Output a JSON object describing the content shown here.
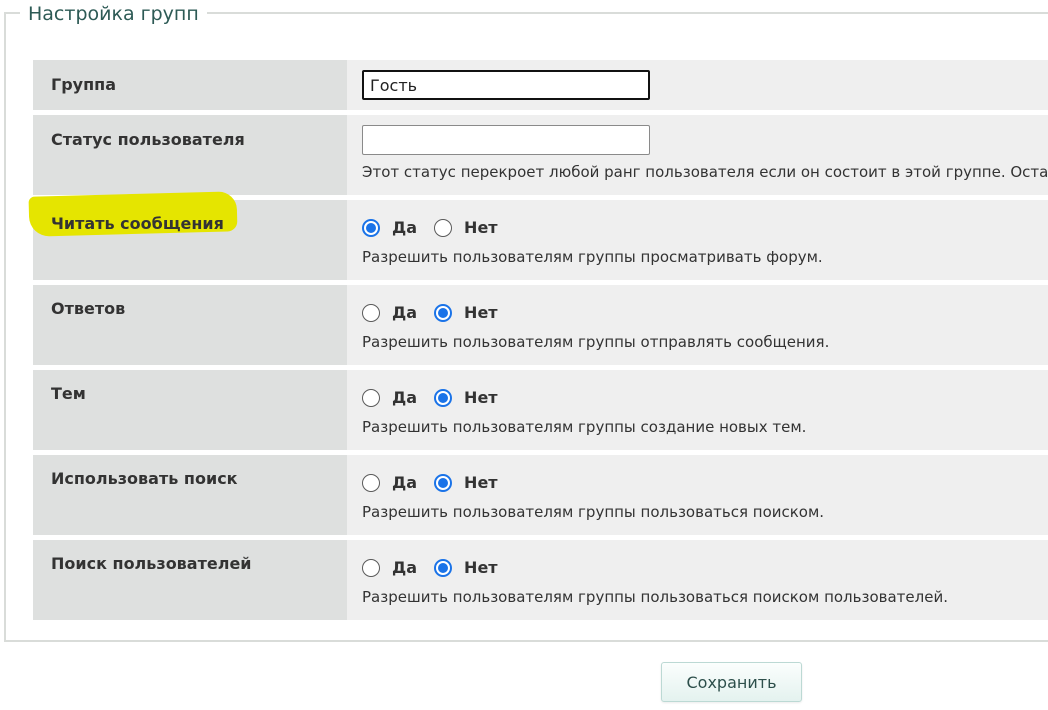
{
  "fieldset": {
    "legend": "Настройка групп"
  },
  "rows": {
    "group": {
      "label": "Группа",
      "value": "Гость"
    },
    "status": {
      "label": "Статус пользователя",
      "value": "",
      "description": "Этот статус перекроет любой ранг пользователя если он состоит в этой группе. Оста"
    },
    "read": {
      "label": "Читать сообщения",
      "yes": "Да",
      "no": "Нет",
      "selected": "yes",
      "description": "Разрешить пользователям группы просматривать форум."
    },
    "replies": {
      "label": "Ответов",
      "yes": "Да",
      "no": "Нет",
      "selected": "no",
      "description": "Разрешить пользователям группы отправлять сообщения."
    },
    "topics": {
      "label": "Тем",
      "yes": "Да",
      "no": "Нет",
      "selected": "no",
      "description": "Разрешить пользователям группы создание новых тем."
    },
    "search": {
      "label": "Использовать поиск",
      "yes": "Да",
      "no": "Нет",
      "selected": "no",
      "description": "Разрешить пользователям группы пользоваться поиском."
    },
    "user_search": {
      "label": "Поиск пользователей",
      "yes": "Да",
      "no": "Нет",
      "selected": "no",
      "description": "Разрешить пользователям группы пользоваться поиском пользователей."
    }
  },
  "actions": {
    "save_label": "Сохранить"
  },
  "colors": {
    "accent": "#1a73e8",
    "highlight": "#e5e500",
    "legend": "#2d5a55"
  }
}
